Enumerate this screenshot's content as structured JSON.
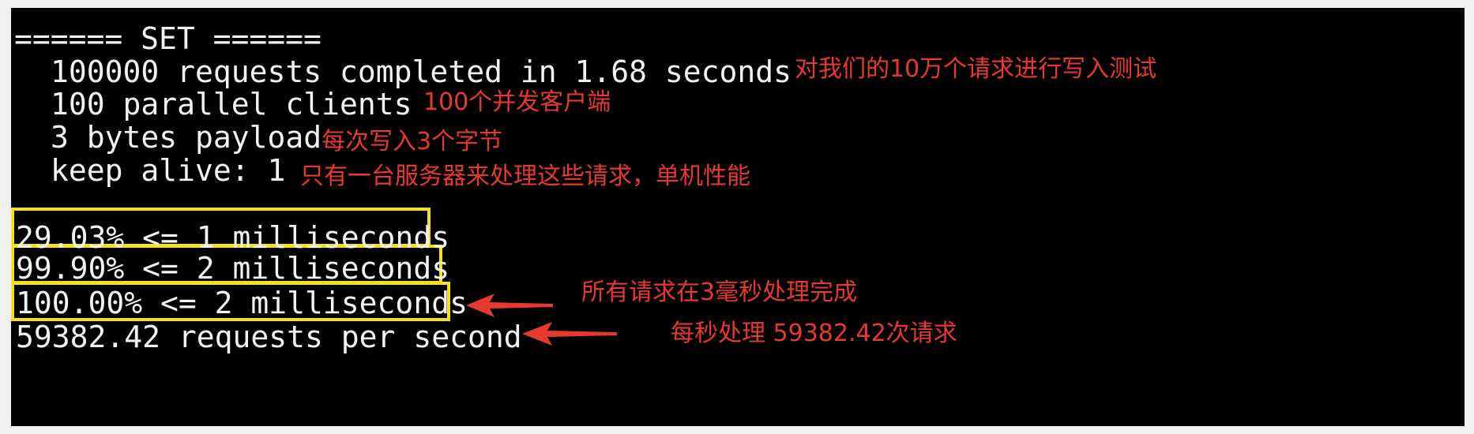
{
  "terminal": {
    "header": "====== SET ======",
    "summary_lines": [
      "100000 requests completed in 1.68 seconds",
      "100 parallel clients",
      "3 bytes payload",
      "keep alive: 1"
    ],
    "latency_lines": [
      "29.03% <= 1 milliseconds",
      "99.90% <= 2 milliseconds",
      "100.00% <= 2 milliseconds"
    ],
    "throughput_line": "59382.42 requests per second"
  },
  "annotations": {
    "requests_note": "对我们的10万个请求进行写入测试",
    "clients_note": "100个并发客户端",
    "payload_note": "每次写入3个字节",
    "keepalive_note": "只有一台服务器来处理这些请求，单机性能",
    "completion_note": "所有请求在3毫秒处理完成",
    "throughput_note": "每秒处理 59382.42次请求"
  },
  "colors": {
    "terminal_bg": "#000000",
    "terminal_text": "#f2f2f2",
    "highlight_box": "#f5e11a",
    "annotation": "#e8392d"
  }
}
